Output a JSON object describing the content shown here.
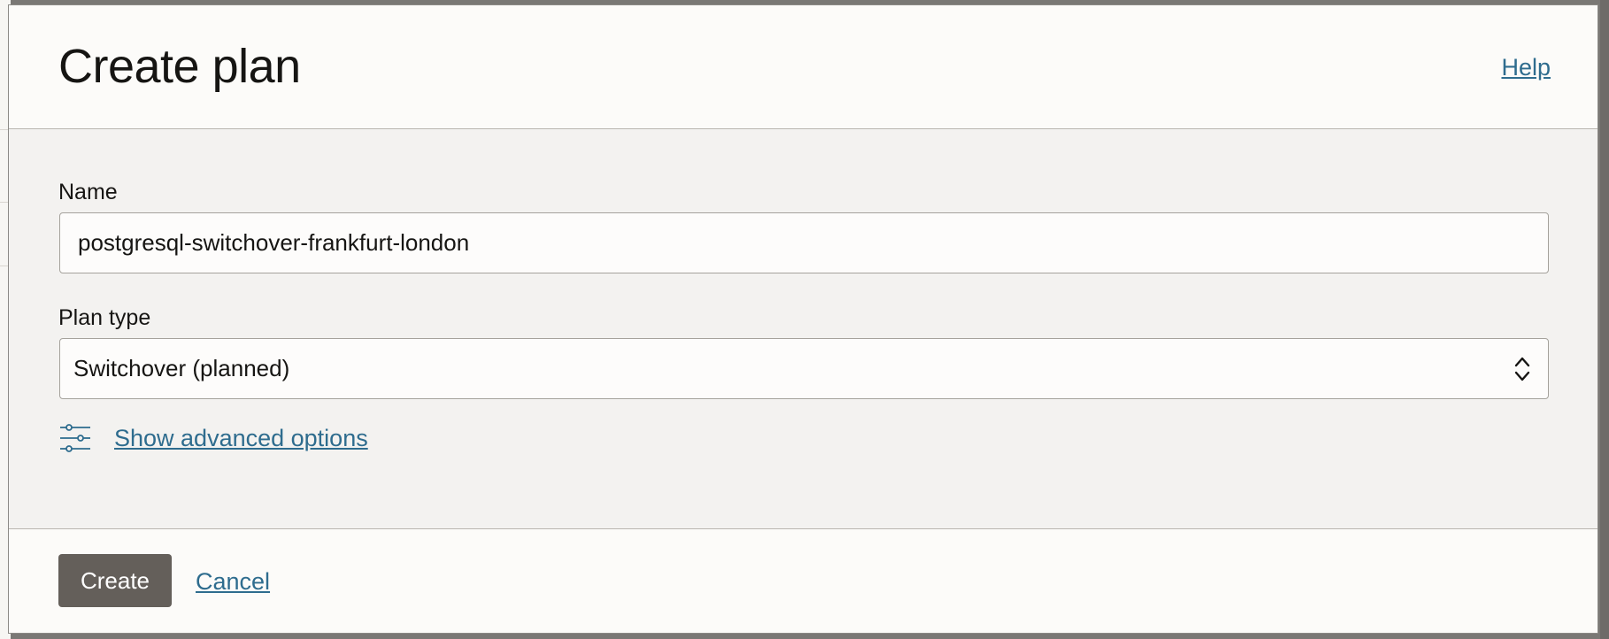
{
  "dialog": {
    "title": "Create plan",
    "help_label": "Help"
  },
  "form": {
    "name": {
      "label": "Name",
      "value": "postgresql-switchover-frankfurt-london"
    },
    "plan_type": {
      "label": "Plan type",
      "selected": "Switchover (planned)"
    },
    "advanced_label": "Show advanced options"
  },
  "footer": {
    "create_label": "Create",
    "cancel_label": "Cancel"
  },
  "icons": {
    "advanced": "sliders-icon",
    "select": "chevron-up-down-icon"
  },
  "colors": {
    "link": "#2e6c8e",
    "primary_button": "#645f5a",
    "body_background": "#f3f2f0"
  }
}
